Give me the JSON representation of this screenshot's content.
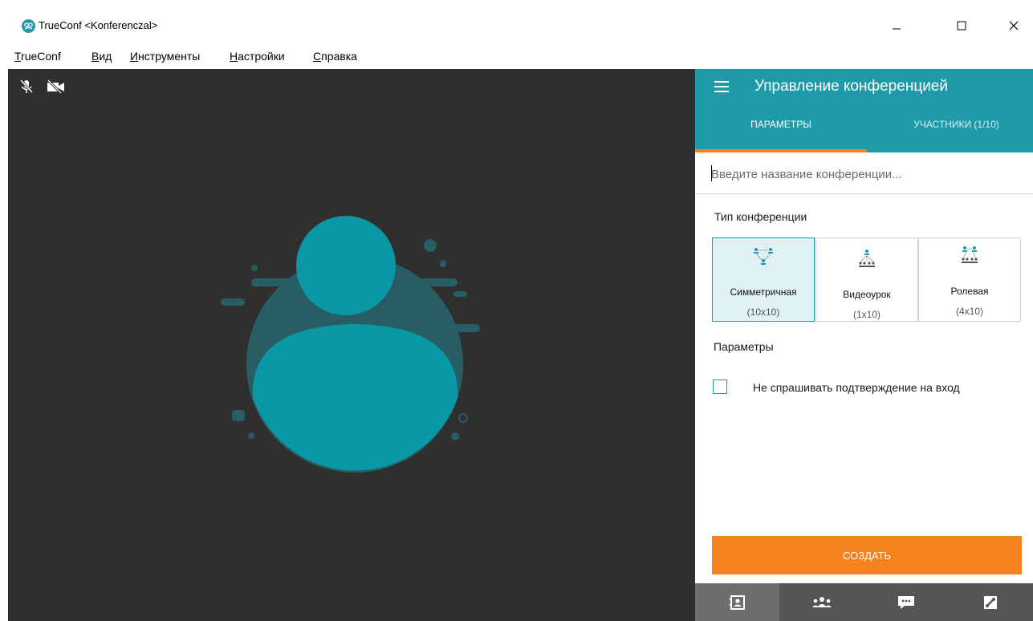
{
  "window": {
    "title": "TrueConf <Konferenczal>",
    "minimize_label": "—",
    "maximize_label": "☐",
    "close_label": "✕"
  },
  "menu": [
    {
      "accel": "T",
      "rest": "rueConf"
    },
    {
      "accel": "В",
      "rest": "ид"
    },
    {
      "accel": "И",
      "rest": "нструменты"
    },
    {
      "accel": "Н",
      "rest": "астройки"
    },
    {
      "accel": "С",
      "rest": "правка"
    }
  ],
  "video": {
    "mic_icon": "mic-muted-icon",
    "camera_icon": "camera-off-icon",
    "avatar_icon": "user-avatar-icon",
    "accent_color": "#1f9aa8"
  },
  "panel": {
    "title": "Управление конференцией",
    "tabs": [
      {
        "label": "ПАРАМЕТРЫ",
        "active": true
      },
      {
        "label": "УЧАСТНИКИ (1/10)",
        "active": false
      }
    ],
    "name_input": {
      "value": "",
      "placeholder": "Введите название конференции..."
    },
    "type_section_label": "Тип конференции",
    "types": [
      {
        "name": "Симметричная",
        "capacity": "(10x10)",
        "selected": true
      },
      {
        "name": "Видеоурок",
        "capacity": "(1x10)",
        "selected": false
      },
      {
        "name": "Ролевая",
        "capacity": "(4x10)",
        "selected": false
      }
    ],
    "params_section_label": "Параметры",
    "option": {
      "label": "Не спрашивать подтверждение на вход",
      "checked": false
    },
    "create_label": "СОЗДАТЬ",
    "bottom_nav": [
      {
        "icon": "contacts-icon",
        "active": true
      },
      {
        "icon": "group-icon",
        "active": false
      },
      {
        "icon": "chat-icon",
        "active": false
      },
      {
        "icon": "phone-icon",
        "active": false
      }
    ],
    "colors": {
      "header": "#1f9aa8",
      "accent": "#f5821f",
      "selected_bg": "#dff1f4"
    }
  }
}
